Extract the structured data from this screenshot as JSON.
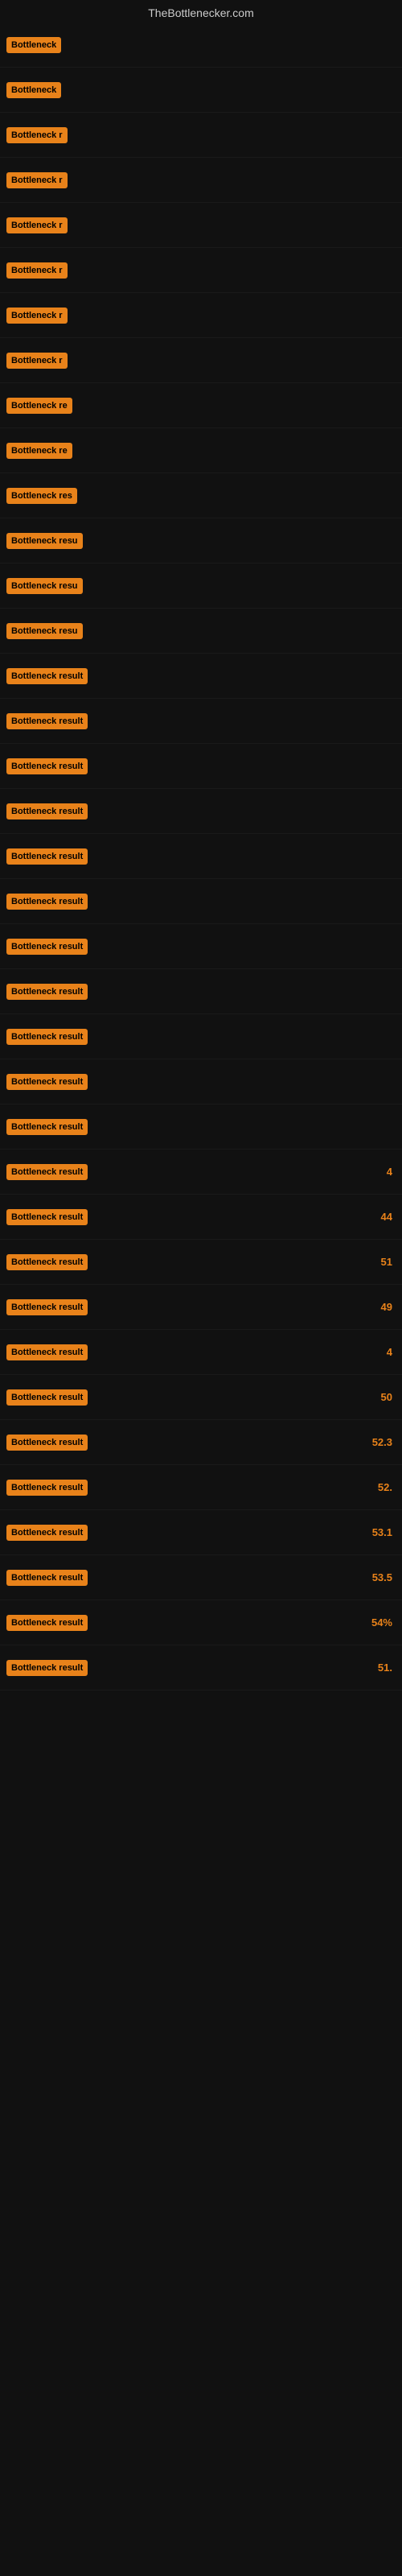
{
  "site_title": "TheBottlenecker.com",
  "rows": [
    {
      "label": "Bottleneck",
      "value": ""
    },
    {
      "label": "Bottleneck",
      "value": ""
    },
    {
      "label": "Bottleneck r",
      "value": ""
    },
    {
      "label": "Bottleneck r",
      "value": ""
    },
    {
      "label": "Bottleneck r",
      "value": ""
    },
    {
      "label": "Bottleneck r",
      "value": ""
    },
    {
      "label": "Bottleneck r",
      "value": ""
    },
    {
      "label": "Bottleneck r",
      "value": ""
    },
    {
      "label": "Bottleneck re",
      "value": ""
    },
    {
      "label": "Bottleneck re",
      "value": ""
    },
    {
      "label": "Bottleneck res",
      "value": ""
    },
    {
      "label": "Bottleneck resu",
      "value": ""
    },
    {
      "label": "Bottleneck resu",
      "value": ""
    },
    {
      "label": "Bottleneck resu",
      "value": ""
    },
    {
      "label": "Bottleneck result",
      "value": ""
    },
    {
      "label": "Bottleneck result",
      "value": ""
    },
    {
      "label": "Bottleneck result",
      "value": ""
    },
    {
      "label": "Bottleneck result",
      "value": ""
    },
    {
      "label": "Bottleneck result",
      "value": ""
    },
    {
      "label": "Bottleneck result",
      "value": ""
    },
    {
      "label": "Bottleneck result",
      "value": ""
    },
    {
      "label": "Bottleneck result",
      "value": ""
    },
    {
      "label": "Bottleneck result",
      "value": ""
    },
    {
      "label": "Bottleneck result",
      "value": ""
    },
    {
      "label": "Bottleneck result",
      "value": ""
    },
    {
      "label": "Bottleneck result",
      "value": "4"
    },
    {
      "label": "Bottleneck result",
      "value": "44"
    },
    {
      "label": "Bottleneck result",
      "value": "51"
    },
    {
      "label": "Bottleneck result",
      "value": "49"
    },
    {
      "label": "Bottleneck result",
      "value": "4"
    },
    {
      "label": "Bottleneck result",
      "value": "50"
    },
    {
      "label": "Bottleneck result",
      "value": "52.3"
    },
    {
      "label": "Bottleneck result",
      "value": "52."
    },
    {
      "label": "Bottleneck result",
      "value": "53.1"
    },
    {
      "label": "Bottleneck result",
      "value": "53.5"
    },
    {
      "label": "Bottleneck result",
      "value": "54%"
    },
    {
      "label": "Bottleneck result",
      "value": "51."
    }
  ]
}
